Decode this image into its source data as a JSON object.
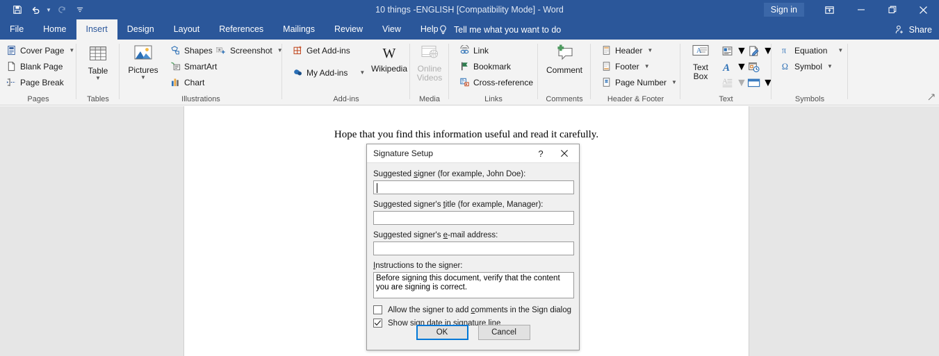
{
  "window": {
    "title": "10 things -ENGLISH [Compatibility Mode]  -  Word",
    "signin_label": "Sign in",
    "ribbon_display_icon": "ribbon-display-options-icon",
    "minimize_icon": "minimize-icon",
    "restore_icon": "restore-icon",
    "close_icon": "close-icon",
    "accent_color": "#2b579a"
  },
  "quick_access": {
    "save": "save-icon",
    "undo": "undo-icon",
    "redo": "redo-icon",
    "customize": "customize-quick-access-toolbar-icon"
  },
  "tabs": [
    {
      "label": "File",
      "active": false
    },
    {
      "label": "Home",
      "active": false
    },
    {
      "label": "Insert",
      "active": true
    },
    {
      "label": "Design",
      "active": false
    },
    {
      "label": "Layout",
      "active": false
    },
    {
      "label": "References",
      "active": false
    },
    {
      "label": "Mailings",
      "active": false
    },
    {
      "label": "Review",
      "active": false
    },
    {
      "label": "View",
      "active": false
    },
    {
      "label": "Help",
      "active": false
    }
  ],
  "tell_me": {
    "icon": "lightbulb-icon",
    "label": "Tell me what you want to do"
  },
  "share": {
    "icon": "share-person-icon",
    "label": "Share"
  },
  "ribbon": {
    "groups": {
      "pages": {
        "label": "Pages",
        "cover_page": "Cover Page",
        "blank_page": "Blank Page",
        "page_break": "Page Break"
      },
      "tables": {
        "label": "Tables",
        "table": "Table"
      },
      "illustrations": {
        "label": "Illustrations",
        "pictures": "Pictures",
        "shapes": "Shapes",
        "smartart": "SmartArt",
        "chart": "Chart",
        "screenshot": "Screenshot"
      },
      "addins": {
        "label": "Add-ins",
        "get_addins": "Get Add-ins",
        "my_addins": "My Add-ins",
        "wikipedia": "Wikipedia"
      },
      "media": {
        "label": "Media",
        "online_videos_line1": "Online",
        "online_videos_line2": "Videos"
      },
      "links": {
        "label": "Links",
        "link": "Link",
        "bookmark": "Bookmark",
        "cross_reference": "Cross-reference"
      },
      "comments": {
        "label": "Comments",
        "comment": "Comment"
      },
      "header_footer": {
        "label": "Header & Footer",
        "header": "Header",
        "footer": "Footer",
        "page_number": "Page Number"
      },
      "text": {
        "label": "Text",
        "text_box_line1": "Text",
        "text_box_line2": "Box",
        "quick_parts": "quick-parts-icon",
        "signature_line": "signature-line-icon",
        "wordart": "wordart-icon",
        "date_time": "date-and-time-icon",
        "drop_cap": "drop-cap-icon",
        "object": "object-icon"
      },
      "symbols": {
        "label": "Symbols",
        "equation": "Equation",
        "symbol": "Symbol"
      }
    },
    "dialog_launcher": "ribbon-collapse-icon"
  },
  "document": {
    "paragraph": "Hope that you find this information useful and read it carefully."
  },
  "dialog": {
    "title": "Signature Setup",
    "help_label": "?",
    "close_icon": "close-icon",
    "fields": [
      {
        "label_pre": "Suggested ",
        "label_accel": "s",
        "label_post": "igner (for example, John Doe):",
        "value": "",
        "name": "suggested-signer"
      },
      {
        "label_pre": "Suggested signer's ",
        "label_accel": "t",
        "label_post": "itle (for example, Manager):",
        "value": "",
        "name": "suggested-signer-title"
      },
      {
        "label_pre": "Suggested signer's ",
        "label_accel": "e",
        "label_post": "-mail address:",
        "value": "",
        "name": "suggested-signer-email"
      }
    ],
    "instructions": {
      "label_pre": "",
      "label_accel": "I",
      "label_post": "nstructions to the signer:",
      "value": "Before signing this document, verify that the content you are signing is correct."
    },
    "checkbox_allow_comments": {
      "pre": "Allow the signer to add ",
      "accel": "c",
      "post": "omments in the Sign dialog",
      "checked": false
    },
    "checkbox_show_date": {
      "pre": "Show sign ",
      "accel": "d",
      "post": "ate in signature line",
      "checked": true
    },
    "ok_label": "OK",
    "cancel_label": "Cancel",
    "focus_color": "#0078d7"
  }
}
